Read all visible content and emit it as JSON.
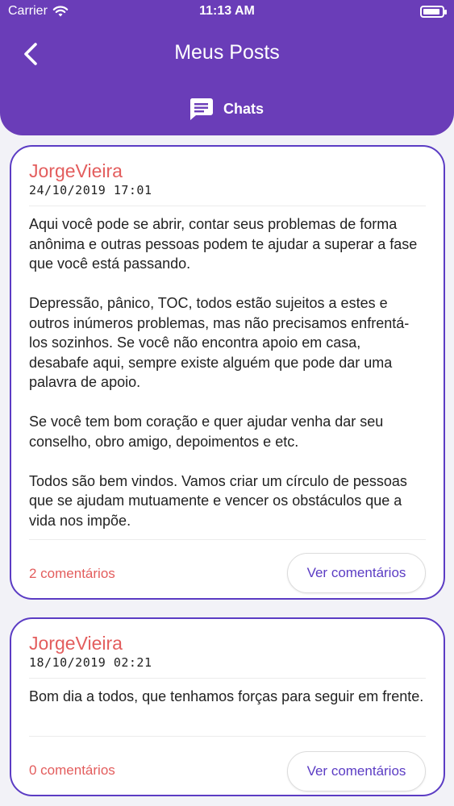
{
  "status": {
    "carrier": "Carrier",
    "time": "11:13 AM",
    "battery_level": 0.9
  },
  "header": {
    "title": "Meus Posts",
    "tab_label": "Chats"
  },
  "posts": [
    {
      "author": "JorgeVieira",
      "date": "24/10/2019 17:01",
      "body": "Aqui você pode se abrir, contar seus problemas de forma anônima e outras pessoas podem  te ajudar a superar a fase que você está passando.\n\nDepressão, pânico, TOC, todos estão sujeitos a estes e outros inúmeros problemas, mas não precisamos enfrentá-los sozinhos. Se você não encontra apoio em casa, desabafe aqui, sempre existe alguém que pode dar uma palavra de apoio.\n\nSe você tem bom coração e quer ajudar venha dar seu conselho, obro amigo, depoimentos e etc.\n\nTodos são bem vindos. Vamos criar um círculo de pessoas que se ajudam mutuamente e vencer os obstáculos que a vida nos impõe.",
      "comments": "2 comentários",
      "button": "Ver comentários"
    },
    {
      "author": "JorgeVieira",
      "date": "18/10/2019 02:21",
      "body": "Bom dia a todos, que tenhamos forças para seguir em frente.",
      "comments": "0 comentários",
      "button": "Ver comentários"
    }
  ]
}
